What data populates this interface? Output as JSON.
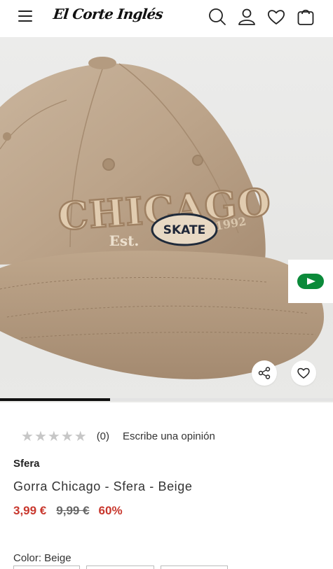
{
  "header": {
    "logo_text": "El Corte Inglés",
    "icons": [
      "menu-icon",
      "search-icon",
      "user-icon",
      "heart-icon",
      "bag-icon"
    ]
  },
  "gallery": {
    "embroidery_text": "CHICAGO",
    "patch_text": "SKATE",
    "est_text": "Est.",
    "year_text": "1992",
    "progress_fraction": 0.33,
    "badge_color": "#0b8a3a"
  },
  "product": {
    "rating_stars": 0,
    "rating_count": "(0)",
    "review_link": "Escribe una opinión",
    "brand": "Sfera",
    "title": "Gorra Chicago - Sfera - Beige",
    "price_now": "3,99 €",
    "price_old": "9,99 €",
    "discount": "60%",
    "color_label": "Color: Beige"
  },
  "colors": {
    "accent_red": "#c8372d",
    "text": "#222222"
  }
}
